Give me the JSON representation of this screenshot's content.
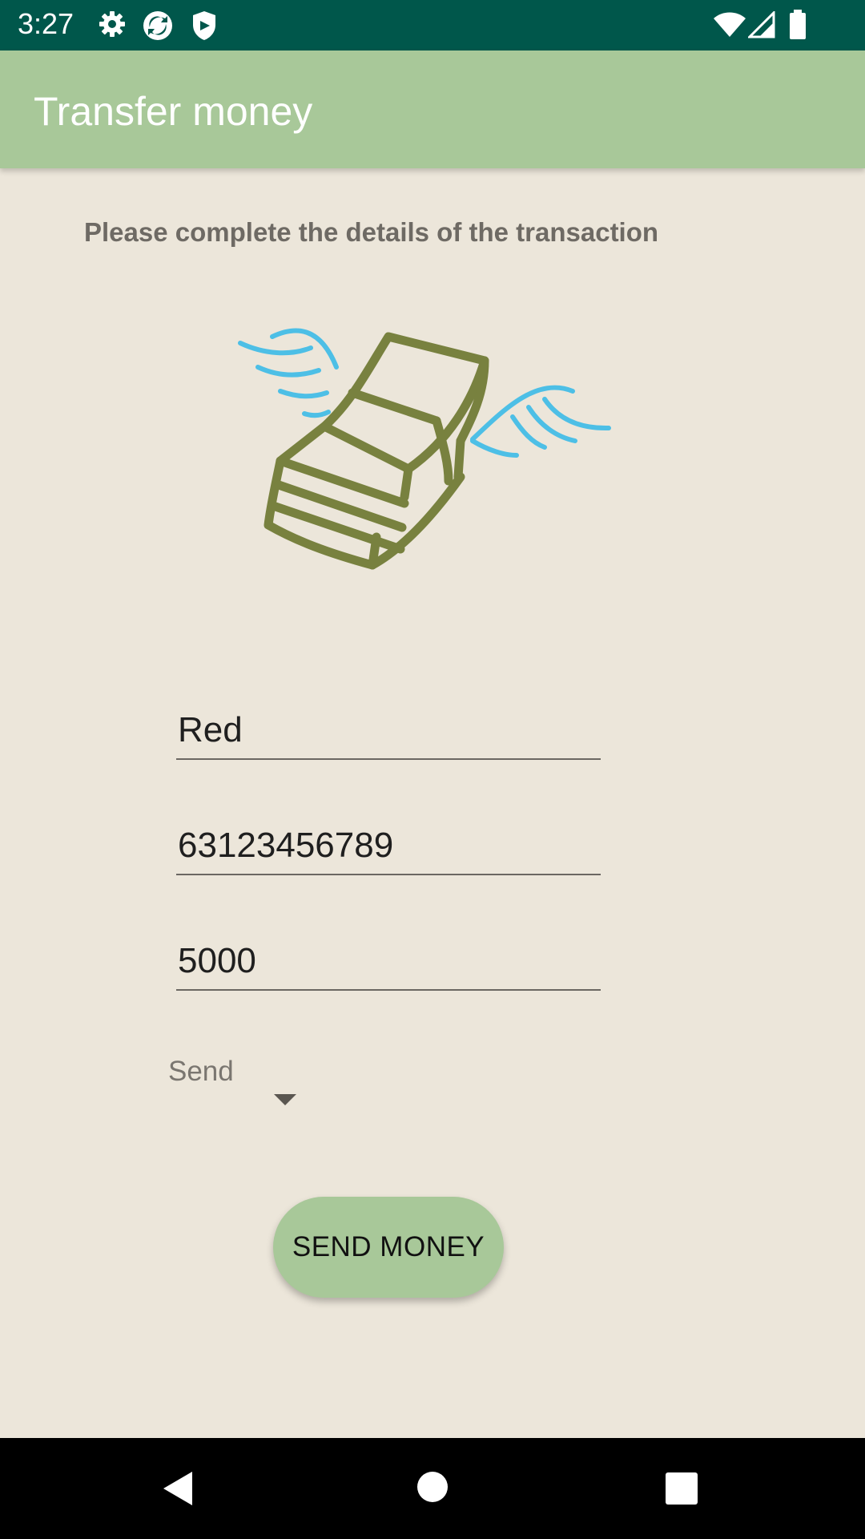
{
  "status_bar": {
    "time": "3:27",
    "icons": [
      "settings-icon",
      "sync-icon",
      "shield-icon",
      "wifi-icon",
      "cell-signal-icon",
      "battery-icon"
    ]
  },
  "app_bar": {
    "title": "Transfer money"
  },
  "main": {
    "instruction": "Please complete the details of the transaction",
    "illustration": "flying-money-icon",
    "fields": {
      "name_value": "Red",
      "account_value": "63123456789",
      "amount_value": "5000"
    },
    "spinner": {
      "selected": "Send"
    },
    "send_button_label": "SEND MONEY"
  },
  "nav_bar": {
    "buttons": [
      "back-icon",
      "home-icon",
      "recents-icon"
    ]
  },
  "colors": {
    "status_bar": "#00574B",
    "app_bar": "#A8C899",
    "background": "#ECE6DA",
    "money": "#78813F",
    "wings": "#4DBFE6"
  }
}
